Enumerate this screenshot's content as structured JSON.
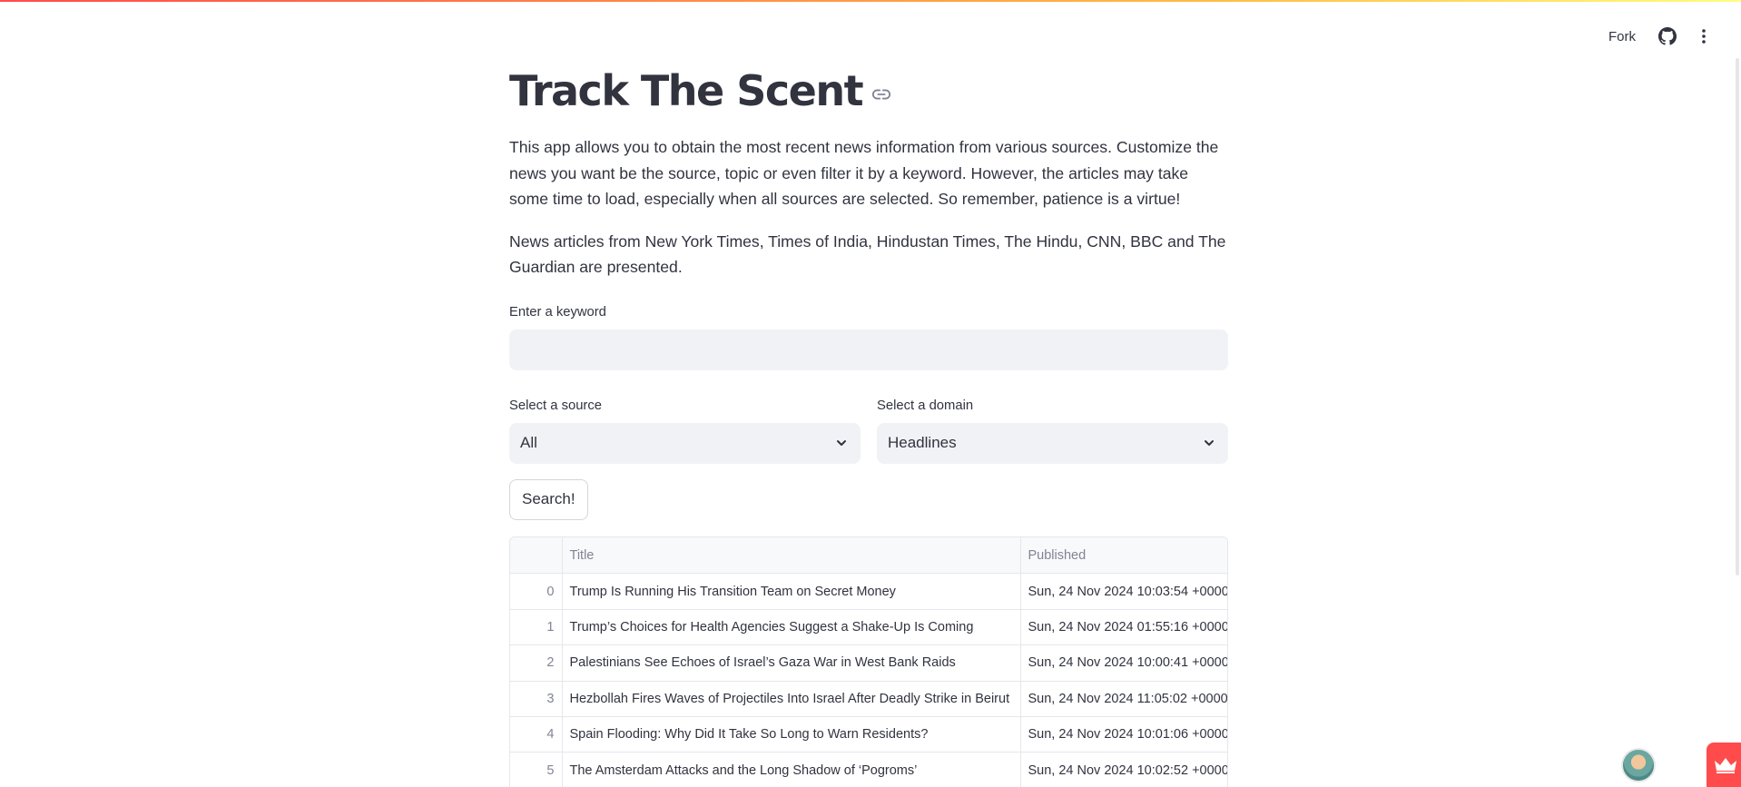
{
  "toolbar": {
    "fork_label": "Fork",
    "github_icon": "github-icon",
    "menu_icon": "kebab-menu-icon"
  },
  "page": {
    "title": "Track The Scent",
    "anchor_icon": "link-icon",
    "intro": "This app allows you to obtain the most recent news information from various sources. Customize the news you want be the source, topic or even filter it by a keyword. However, the articles may take some time to load, especially when all sources are selected. So remember, patience is a virtue!",
    "sources_note": "News articles from New York Times, Times of India, Hindustan Times, The Hindu, CNN, BBC and The Guardian are presented."
  },
  "form": {
    "keyword_label": "Enter a keyword",
    "keyword_value": "",
    "source_label": "Select a source",
    "source_value": "All",
    "domain_label": "Select a domain",
    "domain_value": "Headlines",
    "search_label": "Search!"
  },
  "table": {
    "columns": [
      "",
      "Title",
      "Published"
    ],
    "rows": [
      {
        "index": "0",
        "title": "Trump Is Running His Transition Team on Secret Money",
        "published": "Sun, 24 Nov 2024 10:03:54 +0000"
      },
      {
        "index": "1",
        "title": "Trump’s Choices for Health Agencies Suggest a Shake-Up Is Coming",
        "published": "Sun, 24 Nov 2024 01:55:16 +0000"
      },
      {
        "index": "2",
        "title": "Palestinians See Echoes of Israel’s Gaza War in West Bank Raids",
        "published": "Sun, 24 Nov 2024 10:00:41 +0000"
      },
      {
        "index": "3",
        "title": "Hezbollah Fires Waves of Projectiles Into Israel After Deadly Strike in Beirut",
        "published": "Sun, 24 Nov 2024 11:05:02 +0000"
      },
      {
        "index": "4",
        "title": "Spain Flooding: Why Did It Take So Long to Warn Residents?",
        "published": "Sun, 24 Nov 2024 10:01:06 +0000"
      },
      {
        "index": "5",
        "title": "The Amsterdam Attacks and the Long Shadow of ‘Pogroms’",
        "published": "Sun, 24 Nov 2024 10:02:52 +0000"
      },
      {
        "index": "",
        "title": "",
        "published": ""
      }
    ]
  },
  "colors": {
    "accent": "#ff4b4b",
    "text": "#31333f",
    "input_bg": "#f0f2f6"
  },
  "floating": {
    "avatar_icon": "user-avatar",
    "crown_icon": "crown-icon"
  }
}
